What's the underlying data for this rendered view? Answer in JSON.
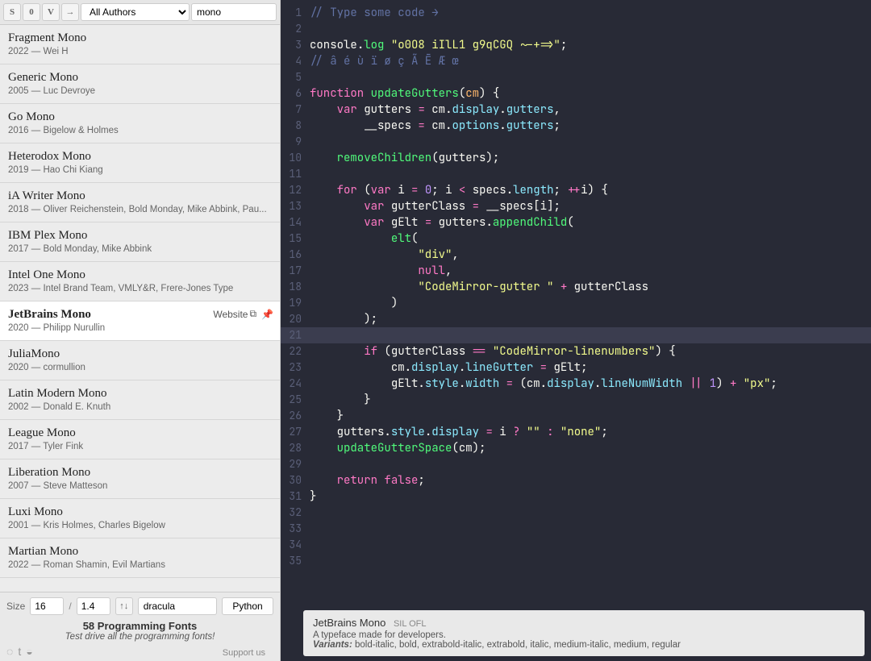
{
  "toolbar": {
    "strike_btn": "S",
    "zero_btn": "0",
    "v_btn": "V",
    "arrow_btn": "→",
    "author_filter": "All Authors",
    "search_value": "mono"
  },
  "fonts": [
    {
      "name": "Fragment Mono",
      "year": "2022",
      "author": "Wei H"
    },
    {
      "name": "Generic Mono",
      "year": "2005",
      "author": "Luc Devroye"
    },
    {
      "name": "Go Mono",
      "year": "2016",
      "author": "Bigelow & Holmes"
    },
    {
      "name": "Heterodox Mono",
      "year": "2019",
      "author": "Hao Chi Kiang"
    },
    {
      "name": "iA Writer Mono",
      "year": "2018",
      "author": "Oliver Reichenstein, Bold Monday, Mike Abbink, Pau..."
    },
    {
      "name": "IBM Plex Mono",
      "year": "2017",
      "author": "Bold Monday, Mike Abbink"
    },
    {
      "name": "Intel One Mono",
      "year": "2023",
      "author": "Intel Brand Team, VMLY&R, Frere-Jones Type"
    },
    {
      "name": "JetBrains Mono",
      "year": "2020",
      "author": "Philipp Nurullin",
      "selected": true
    },
    {
      "name": "JuliaMono",
      "year": "2020",
      "author": "cormullion"
    },
    {
      "name": "Latin Modern Mono",
      "year": "2002",
      "author": "Donald E. Knuth"
    },
    {
      "name": "League Mono",
      "year": "2017",
      "author": "Tyler Fink"
    },
    {
      "name": "Liberation Mono",
      "year": "2007",
      "author": "Steve Matteson"
    },
    {
      "name": "Luxi Mono",
      "year": "2001",
      "author": "Kris Holmes, Charles Bigelow"
    },
    {
      "name": "Martian Mono",
      "year": "2022",
      "author": "Roman Shamin, Evil Martians"
    }
  ],
  "selected_extra": {
    "website": "Website",
    "pin": "☆"
  },
  "bottom": {
    "size_label": "Size",
    "size_value": "16",
    "sep": "/",
    "spacing_value": "1.4",
    "sort": "↑↓",
    "theme": "dracula",
    "lang": "Python",
    "tag1": "58 Programming Fonts",
    "tag2": "Test drive all the programming fonts!",
    "support": "Support us"
  },
  "info": {
    "name": "JetBrains Mono",
    "license": "SIL OFL",
    "desc": "A typeface made for developers.",
    "variants_label": "Variants:",
    "variants": "bold-italic, bold, extrabold-italic, extrabold, italic, medium-italic, medium, regular"
  },
  "code_lines": 35
}
